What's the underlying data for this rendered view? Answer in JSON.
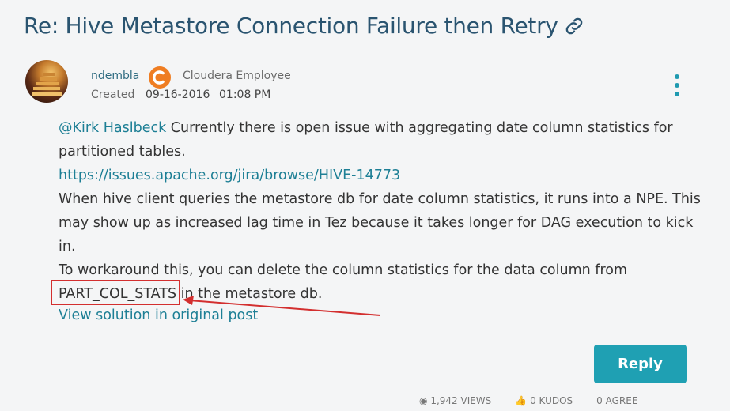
{
  "post": {
    "title": "Re: Hive Metastore Connection Failure then Retry",
    "author": "ndembla",
    "rank": "Cloudera Employee",
    "created_label": "Created",
    "created_date": "09-16-2016",
    "created_time": "01:08 PM"
  },
  "body": {
    "mention": "@Kirk Haslbeck",
    "line1_rest": " Currently there is open issue with aggregating date column statistics for",
    "line2": "partitioned tables.",
    "url": "https://issues.apache.org/jira/browse/HIVE-14773",
    "line4": "When hive client queries the metastore db for date column statistics, it runs into a NPE. This",
    "line5": "may show up as increased lag time in Tez because it takes longer for DAG execution to kick",
    "line6": "in.",
    "line7": "To workaround this, you can delete the column statistics for the data column from",
    "line8_code": "PART_COL_STATS",
    "line8_rest": " in the metastore db."
  },
  "actions": {
    "solution_link": "View solution in original post",
    "reply": "Reply"
  },
  "footer": {
    "views": "1,942 VIEWS",
    "kudos": "0 KUDOS",
    "agree": "0 AGREE"
  },
  "colors": {
    "accent": "#1fa0b3",
    "title": "#2a5470",
    "link": "#1d7f95",
    "annotation": "#d32f2f",
    "rank_badge": "#ef7d22"
  },
  "icons": [
    "link-icon",
    "kebab-menu-icon",
    "views-icon",
    "kudos-icon"
  ]
}
